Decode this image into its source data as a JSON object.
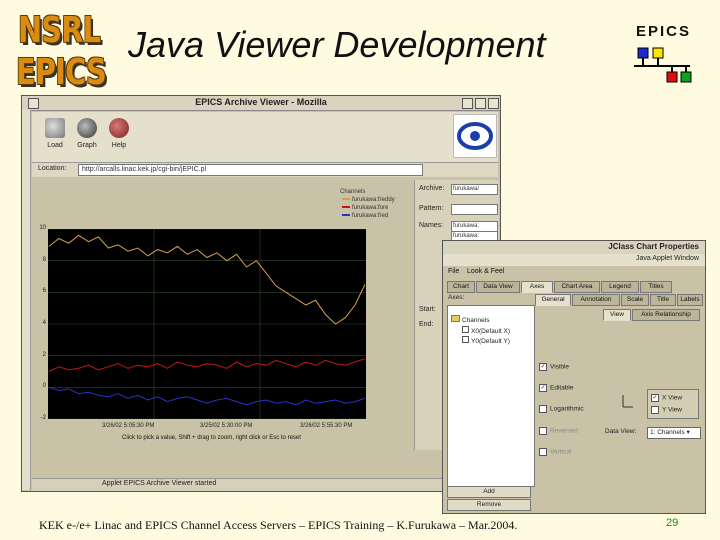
{
  "slide": {
    "logo_line1": "NSRL",
    "logo_line2": "EPICS",
    "title": "Java Viewer Development",
    "epics_label": "EPICS",
    "footer": "KEK e-/e+ Linac and EPICS Channel Access Servers – EPICS Training – K.Furukawa – Mar.2004.",
    "page_number": "29"
  },
  "viewer": {
    "window_title": "EPICS Archive Viewer - Mozilla",
    "toolbar": {
      "load": "Load",
      "graph": "Graph",
      "help": "Help"
    },
    "location_label": "Location:",
    "location_url": "http://arcalls.linac.kek.jp/cgi-bin/jEPIC.pl",
    "legend": {
      "title": "Channels",
      "items": [
        "furukawa:freddy",
        "furukawa:fore",
        "furukawa:fred"
      ]
    },
    "y_ticks": [
      "10",
      "8",
      "6",
      "4",
      "2",
      "0",
      "-2"
    ],
    "x_ticks": [
      "3/26/02 5:05:30 PM",
      "3/25/02 5:30:00 PM",
      "3/26/02 5:55:30 PM"
    ],
    "hint": "Click to pick a value, Shift + drag to zoom, right click or Esc to reset",
    "right_panel": {
      "archive_label": "Archive:",
      "archive_value": "furukawa/",
      "pattern_label": "Pattern:",
      "names_label": "Names:",
      "names_values": [
        "furukawa:",
        "furukawa:"
      ],
      "start_label": "Start:",
      "end_label": "End:"
    },
    "status": "Applet EPICS Archive Viewer started"
  },
  "props": {
    "window_title": "JClass Chart Properties",
    "subtitle": "Java Applet Window",
    "menu": [
      "File",
      "Look & Feel"
    ],
    "tabs1": [
      "Chart",
      "Data View",
      "Axes",
      "Chart Area",
      "Legend",
      "Titles"
    ],
    "tabs2": [
      "General",
      "Annotation",
      "Scale",
      "Title",
      "Labels"
    ],
    "tabs3": [
      "View",
      "Axis Relationship"
    ],
    "axes_label": "Axes:",
    "tree": {
      "root": "Channels",
      "x": "X0(Default X)",
      "y": "Y0(Default Y)"
    },
    "checks": [
      "Visible",
      "Editable",
      "Logarithmic",
      "Reversed",
      "Vertical"
    ],
    "xy_options": [
      "X View",
      "Y View"
    ],
    "data_view_label": "Data View:",
    "data_view_value": "1: Channels",
    "add": "Add",
    "remove": "Remove"
  },
  "chart_data": {
    "type": "line",
    "ylim": [
      -2,
      10
    ],
    "series": [
      {
        "name": "furukawa:freddy",
        "color": "#d4a04a",
        "values": [
          8.9,
          9.4,
          9.1,
          9.6,
          9.2,
          9.5,
          8.8,
          9.0,
          8.6,
          8.8,
          8.3,
          8.7,
          8.5,
          8.9,
          8.4,
          8.7,
          8.2,
          8.5,
          8.0,
          8.4,
          7.6,
          8.0,
          7.2,
          6.4,
          6.0,
          5.6,
          5.2,
          5.5,
          4.6,
          4.0,
          4.4,
          5.2,
          6.5
        ]
      },
      {
        "name": "furukawa:fore",
        "color": "#c21818",
        "values": [
          1.0,
          1.3,
          1.1,
          1.2,
          1.4,
          1.1,
          1.3,
          1.5,
          1.2,
          1.4,
          1.3,
          1.5,
          1.2,
          1.6,
          1.4,
          1.3,
          1.5,
          1.4,
          1.2,
          1.6,
          1.3,
          1.5,
          1.4,
          1.7,
          1.5,
          1.3,
          1.6,
          1.4,
          1.7,
          1.5,
          1.4,
          1.6,
          1.8
        ]
      },
      {
        "name": "furukawa:fred",
        "color": "#2a32c8",
        "values": [
          0.0,
          -0.2,
          -0.1,
          -0.4,
          -0.3,
          -0.5,
          -0.6,
          -0.4,
          -0.7,
          -0.5,
          -0.8,
          -0.6,
          -0.9,
          -0.7,
          -0.6,
          -0.8,
          -1.0,
          -0.8,
          -0.7,
          -0.9,
          -1.1,
          -0.9,
          -0.8,
          -1.0,
          -0.9,
          -1.1,
          -0.8,
          -1.0,
          -0.9,
          -0.8,
          -1.0,
          -0.9,
          -0.7
        ]
      }
    ]
  }
}
